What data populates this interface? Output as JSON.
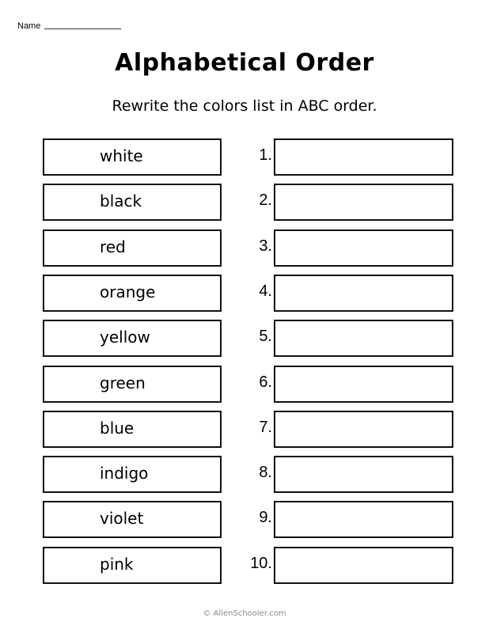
{
  "header": {
    "name_label": "Name",
    "title": "Alphabetical Order",
    "instructions": "Rewrite the colors list in ABC order."
  },
  "words": [
    "white",
    "black",
    "red",
    "orange",
    "yellow",
    "green",
    "blue",
    "indigo",
    "violet",
    "pink"
  ],
  "answer_numbers": [
    "1.",
    "2.",
    "3.",
    "4.",
    "5.",
    "6.",
    "7.",
    "8.",
    "9.",
    "10."
  ],
  "answers": [
    "",
    "",
    "",
    "",
    "",
    "",
    "",
    "",
    "",
    ""
  ],
  "footer": "© AlienSchooler.com"
}
